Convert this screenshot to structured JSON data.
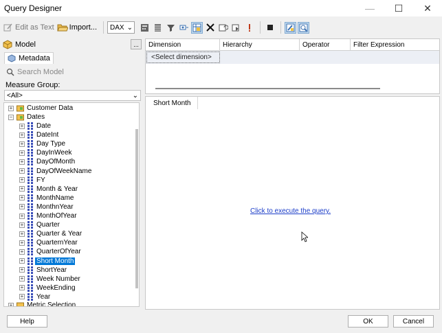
{
  "window": {
    "title": "Query Designer"
  },
  "toolbar": {
    "edit_as_text": "Edit as Text",
    "import": "Import...",
    "language": "DAX"
  },
  "left": {
    "model_label": "Model",
    "ellipsis": "...",
    "metadata_tab": "Metadata",
    "search_placeholder": "Search Model",
    "measure_group_label": "Measure Group:",
    "measure_group_value": "<All>"
  },
  "tree": {
    "folders": [
      {
        "label": "Customer Data",
        "expander": "+"
      },
      {
        "label": "Dates",
        "expander": "−"
      }
    ],
    "date_items": [
      "Date",
      "DateInt",
      "Day Type",
      "DayInWeek",
      "DayOfMonth",
      "DayOfWeekName",
      "FY",
      "Month & Year",
      "MonthName",
      "MonthnYear",
      "MonthOfYear",
      "Quarter",
      "Quarter & Year",
      "QuarternYear",
      "QuarterOfYear",
      "Short Month",
      "ShortYear",
      "Week Number",
      "WeekEnding",
      "Year"
    ],
    "last_folder": "Metric Selection",
    "selected": "Short Month"
  },
  "filter_grid": {
    "columns": [
      "Dimension",
      "Hierarchy",
      "Operator",
      "Filter Expression"
    ],
    "placeholder_row": "<Select dimension>"
  },
  "result": {
    "column": "Short Month",
    "execute_link": "Click to execute the query."
  },
  "footer": {
    "help": "Help",
    "ok": "OK",
    "cancel": "Cancel"
  }
}
